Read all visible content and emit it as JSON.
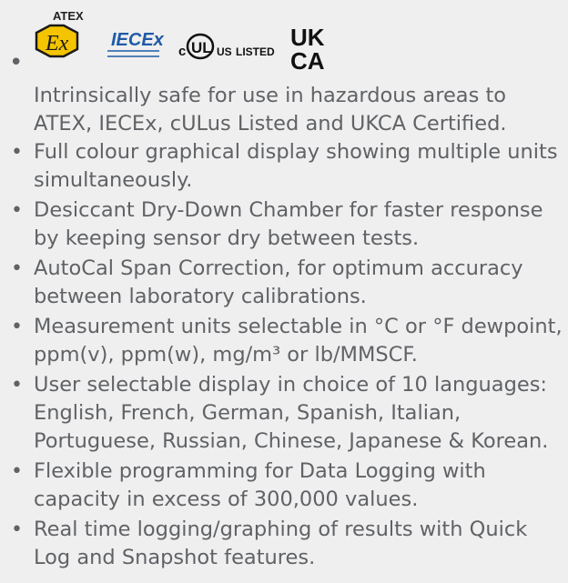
{
  "logos": {
    "atex_label": "ATEX",
    "atex_symbol_text": "Ex",
    "iecex_text": "IECEx",
    "cul_c": "c",
    "cul_ul": "UL",
    "cul_us": "US",
    "cul_listed": "LISTED",
    "ukca_top": "UK",
    "ukca_bottom": "CA",
    "ex_symbol_color": "#f5c400"
  },
  "intro_text": "Intrinsically safe for use in hazardous areas to ATEX, IECEx, cULus Listed and UKCA Certified.",
  "features": [
    "Full colour graphical display showing multiple units simultaneously.",
    "Desiccant Dry-Down Chamber for faster response by keeping sensor dry between tests.",
    "AutoCal Span Correction, for optimum accuracy between laboratory calibrations.",
    "Measurement units selectable in °C or °F dewpoint, ppm(v), ppm(w), mg/m³ or lb/MMSCF.",
    "User selectable display in choice of 10 languages: English, French, German, Spanish, Italian, Portuguese, Russian, Chinese, Japanese & Korean.",
    "Flexible programming for Data Logging with capacity in excess of 300,000 values.",
    "Real time logging/graphing of results with Quick Log and Snapshot features."
  ]
}
